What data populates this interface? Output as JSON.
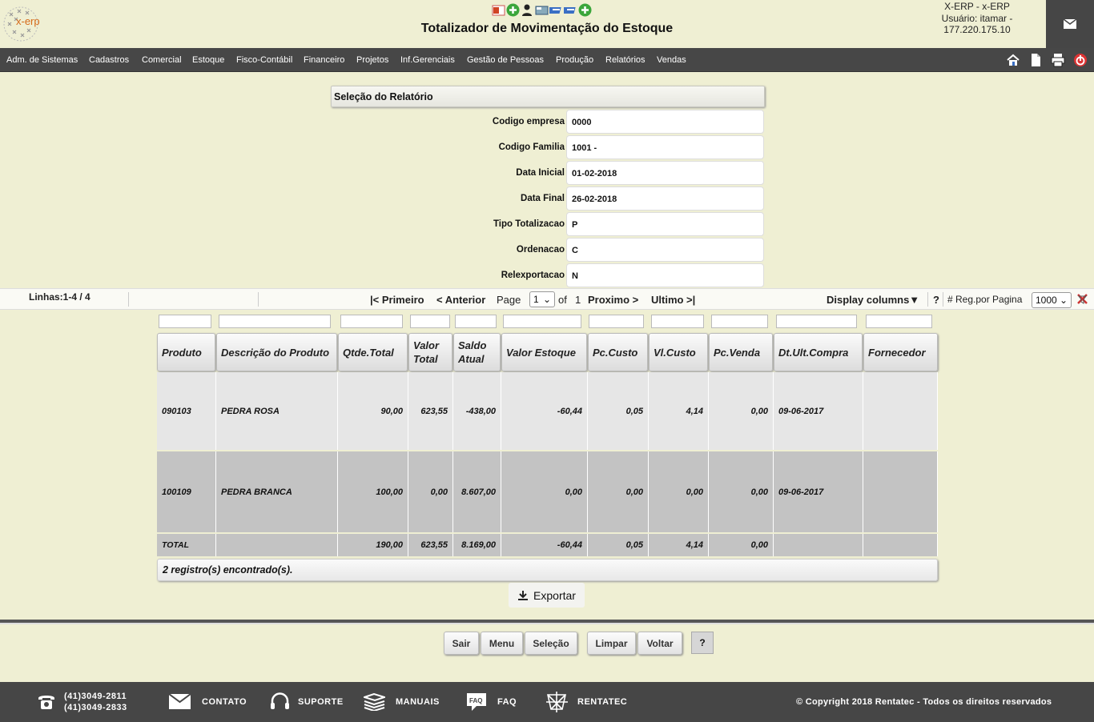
{
  "header": {
    "logo_text": "x-erp",
    "title": "Totalizador de Movimentação do Estoque",
    "user_line1": "X-ERP - x-ERP",
    "user_line2": "Usuário: itamar -",
    "user_line3": "177.220.175.10"
  },
  "menu": [
    "Adm. de Sistemas",
    "Cadastros",
    "Comercial",
    "Estoque",
    "Fisco-Contábil",
    "Financeiro",
    "Projetos",
    "Inf.Gerenciais",
    "Gestão de Pessoas",
    "Produção",
    "Relatórios",
    "Vendas"
  ],
  "selection": {
    "header": "Seleção do Relatório",
    "fields": [
      {
        "label": "Codigo empresa",
        "value": "0000"
      },
      {
        "label": "Codigo Familia",
        "value": "1001 -"
      },
      {
        "label": "Data Inicial",
        "value": "01-02-2018"
      },
      {
        "label": "Data Final",
        "value": "26-02-2018"
      },
      {
        "label": "Tipo Totalizacao",
        "value": "P"
      },
      {
        "label": "Ordenacao",
        "value": "C"
      },
      {
        "label": "Relexportacao",
        "value": "N"
      }
    ]
  },
  "pager": {
    "lines": "Linhas:1-4 / 4",
    "first": "|< Primeiro",
    "prev": "< Anterior",
    "page_label": "Page",
    "page_value": "1",
    "of_label": "of",
    "total_pages": "1",
    "next": "Proximo >",
    "last": "Ultimo >|",
    "display_columns": "Display columns▼",
    "help": "?",
    "reg_label": "# Reg.por Pagina",
    "reg_value": "1000"
  },
  "grid": {
    "columns": [
      "Produto",
      "Descrição do Produto",
      "Qtde.Total",
      "Valor Total",
      "Saldo Atual",
      "Valor Estoque",
      "Pc.Custo",
      "Vl.Custo",
      "Pc.Venda",
      "Dt.Ult.Compra",
      "Fornecedor"
    ],
    "rows": [
      [
        "090103",
        "PEDRA ROSA",
        "90,00",
        "623,55",
        "-438,00",
        "-60,44",
        "0,05",
        "4,14",
        "0,00",
        "09-06-2017",
        ""
      ],
      [
        "100109",
        "PEDRA BRANCA",
        "100,00",
        "0,00",
        "8.607,00",
        "0,00",
        "0,00",
        "0,00",
        "0,00",
        "09-06-2017",
        ""
      ]
    ],
    "total": [
      "TOTAL",
      "",
      "190,00",
      "623,55",
      "8.169,00",
      "-60,44",
      "0,05",
      "4,14",
      "0,00",
      "",
      ""
    ],
    "count_text": "2 registro(s) encontrado(s)."
  },
  "export_label": "Exportar",
  "buttons": [
    "Sair",
    "Menu",
    "Seleção",
    "Limpar",
    "Voltar",
    "?"
  ],
  "footer": {
    "phone1": "(41)3049-2811",
    "phone2": "(41)3049-2833",
    "contato": "CONTATO",
    "suporte": "SUPORTE",
    "manuais": "MANUAIS",
    "faq": "FAQ",
    "faq_icon_text": "FAQ",
    "rentatec": "RENTATEC",
    "copyright": "© Copyright 2018 Rentatec - Todos os direitos reservados"
  }
}
